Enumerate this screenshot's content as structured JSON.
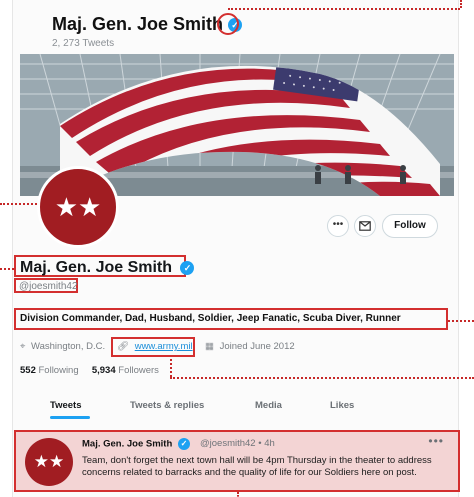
{
  "header": {
    "name": "Maj. Gen. Joe Smith",
    "tweet_count": "2, 273 Tweets"
  },
  "profile": {
    "avatar_glyph": "★★",
    "name": "Maj. Gen. Joe Smith",
    "handle": "@joesmith42",
    "bio": "Division Commander, Dad, Husband, Soldier, Jeep Fanatic, Scuba Diver, Runner",
    "location": "Washington, D.C.",
    "website": "www.army.mil",
    "joined": "Joined June 2012",
    "following_count": "552",
    "following_label": "Following",
    "followers_count": "5,934",
    "followers_label": "Followers"
  },
  "actions": {
    "more": "•••",
    "follow": "Follow"
  },
  "tabs": [
    {
      "label": "Tweets",
      "active": true
    },
    {
      "label": "Tweets & replies",
      "active": false
    },
    {
      "label": "Media",
      "active": false
    },
    {
      "label": "Likes",
      "active": false
    }
  ],
  "tweet": {
    "avatar_glyph": "★★",
    "author": "Maj. Gen. Joe Smith",
    "handle_time": "@joesmith42 • 4h",
    "more": "•••",
    "text": "Team, don't forget the next town hall will be 4pm Thursday in the theater to address concerns related to barracks and the quality of life for our Soldiers here on post."
  },
  "colors": {
    "accent": "#1da1f2",
    "brand_red": "#a11d22",
    "callout_red": "#d32f2f"
  },
  "icons": {
    "verified": "verified-badge-icon",
    "location": "location-pin-icon",
    "link": "link-icon",
    "calendar": "calendar-icon",
    "mail": "mail-icon"
  }
}
